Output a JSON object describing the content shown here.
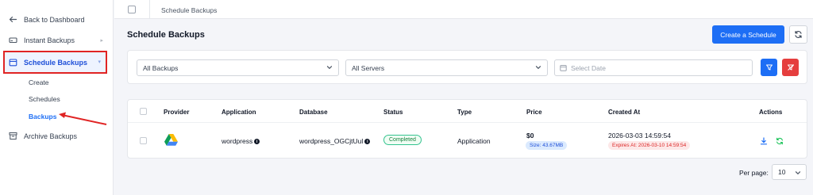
{
  "sidebar": {
    "back_label": "Back to Dashboard",
    "instant_label": "Instant Backups",
    "schedule_label": "Schedule Backups",
    "sub_items": [
      "Create",
      "Schedules",
      "Backups"
    ],
    "archive_label": "Archive Backups"
  },
  "breadcrumb": {
    "current": "Schedule Backups"
  },
  "header": {
    "title": "Schedule Backups",
    "create_label": "Create a Schedule"
  },
  "filters": {
    "backups_value": "All Backups",
    "servers_value": "All Servers",
    "date_placeholder": "Select Date"
  },
  "table": {
    "columns": [
      "Provider",
      "Application",
      "Database",
      "Status",
      "Type",
      "Price",
      "Created At",
      "Actions"
    ],
    "rows": [
      {
        "provider_icon": "google-drive-icon",
        "application": "wordpress",
        "database": "wordpress_OGCjtUul",
        "status": "Completed",
        "type": "Application",
        "price": "$0",
        "size": "Size: 43.67MB",
        "created_at": "2026-03-03 14:59:54",
        "expires": "Expires At: 2026-03-10 14:59:54"
      }
    ]
  },
  "pagination": {
    "per_page_label": "Per page:",
    "per_page_value": "10"
  },
  "colors": {
    "accent": "#1d6ef5",
    "danger": "#e53e3e",
    "success": "#34c38f",
    "annotation": "#e02424"
  }
}
